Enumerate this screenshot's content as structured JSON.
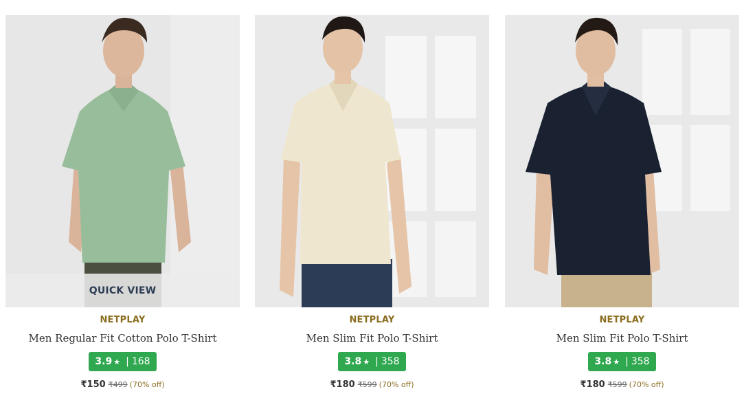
{
  "products": [
    {
      "brand": "NETPLAY",
      "name": "Men Regular Fit Cotton Polo T-Shirt",
      "rating": "3.9",
      "rating_count": "168",
      "price": "₹150",
      "mrp": "₹499",
      "discount": "(70% off)",
      "quick_view_label": "QUICK VIEW",
      "shirt_color": "#98bd9b",
      "pants_color": "#4a4f40"
    },
    {
      "brand": "NETPLAY",
      "name": "Men Slim Fit Polo T-Shirt",
      "rating": "3.8",
      "rating_count": "358",
      "price": "₹180",
      "mrp": "₹599",
      "discount": "(70% off)",
      "shirt_color": "#efe6cf",
      "pants_color": "#2c3b56"
    },
    {
      "brand": "NETPLAY",
      "name": "Men Slim Fit Polo T-Shirt",
      "rating": "3.8",
      "rating_count": "358",
      "price": "₹180",
      "mrp": "₹599",
      "discount": "(70% off)",
      "shirt_color": "#1a2232",
      "pants_color": "#c7b28c"
    }
  ],
  "icons": {
    "rating_star": "star-icon"
  }
}
